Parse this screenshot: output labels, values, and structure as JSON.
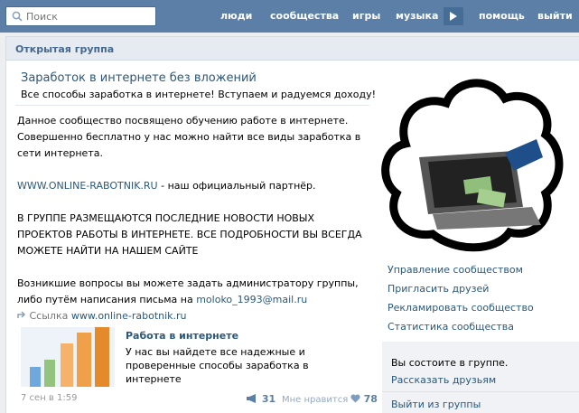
{
  "topbar": {
    "search_placeholder": "Поиск",
    "nav": [
      "люди",
      "сообщества",
      "игры",
      "музыка",
      "помощь",
      "выйти"
    ]
  },
  "group": {
    "header": "Открытая группа",
    "title": "Заработок в интернете без вложений",
    "status": "Все способы заработка в интернете! Вступаем и радуемся доходу!",
    "desc_p1": "Данное сообщество посвящено обучению работе в интернете. Совершенно бесплатно у нас можно найти все виды заработка в сети интернета.",
    "desc_link": "WWW.ONLINE-RABOTNIK.RU",
    "desc_p2_rest": " - наш официальный партнёр.",
    "desc_p3": "В ГРУППЕ РАЗМЕЩАЮТСЯ ПОСЛЕДНИЕ НОВОСТИ НОВЫХ ПРОЕКТОВ РАБОТЫ В ИНТЕРНЕТЕ. ВСЕ ПОДРОБНОСТИ ВЫ ВСЕГДА МОЖЕТЕ НАЙТИ НА НАШЕМ САЙТЕ",
    "desc_p4": "Возникшие вопросы вы можете задать администратору группы, либо путём написания письма на ",
    "email": "moloko_1993@mail.ru"
  },
  "link_attachment": {
    "label": "Ссылка",
    "url": "www.online-rabotnik.ru",
    "card_title": "Работа в интернете",
    "card_desc": "У нас вы найдете все надежные и проверенные способы заработка в интернете"
  },
  "post_footer": {
    "date": "7 сен в 1:59",
    "shares": "31",
    "likes_label": "Мне нравится",
    "likes": "78"
  },
  "side_menu": [
    "Управление сообществом",
    "Пригласить друзей",
    "Рекламировать сообщество",
    "Статистика сообщества"
  ],
  "membership": {
    "status": "Вы состоите в группе.",
    "tell_friends": "Рассказать друзьям",
    "leave": "Выйти из группы"
  }
}
